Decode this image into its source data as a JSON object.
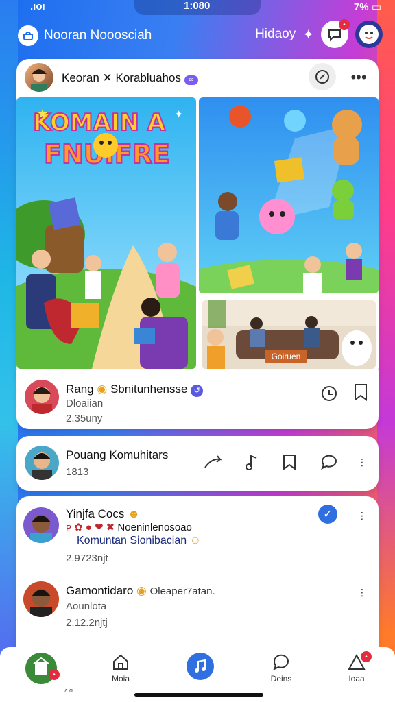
{
  "status": {
    "signal": ".ıoı",
    "time": "1:080",
    "battery": "7%"
  },
  "header": {
    "brand": "Nooran Nooosciah",
    "right_label": "Hidaoy",
    "notif_count": "•"
  },
  "post": {
    "author": "Keoran ✕ Korabluahos",
    "banner_title": [
      "KOMAIN A",
      "FNUIFRE"
    ],
    "video_caption": "Goiruen"
  },
  "comments": [
    {
      "name": "Rang",
      "name_extra": "Sbnitunhensse",
      "sub": "Dloaiian",
      "time": "2.35uny"
    },
    {
      "name": "Pouang Komuhitars",
      "sub": "1813"
    },
    {
      "name": "Yinjfa Cocs",
      "line2a": "Noeninlenosoao",
      "line3": "Komuntan Sionibacian",
      "time": "2.9723njt"
    },
    {
      "name": "Gamontidaro",
      "name_extra": "Oleaper7atan.",
      "sub": "Aounlota",
      "time": "2.12.2njtj"
    }
  ],
  "nav": {
    "items": [
      {
        "label": ""
      },
      {
        "label": "Moia"
      },
      {
        "label": ""
      },
      {
        "label": "Deins"
      },
      {
        "label": "Ioaa"
      }
    ],
    "tiny": "ʌ ɑ"
  }
}
